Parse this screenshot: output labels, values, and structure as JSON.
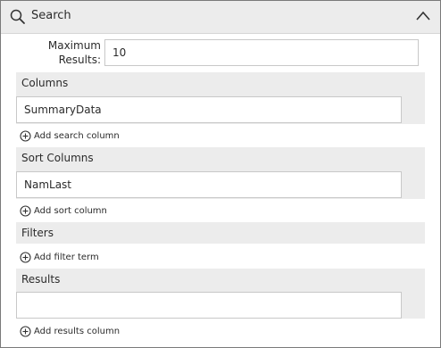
{
  "header": {
    "title": "Search",
    "search_icon": "search-icon",
    "collapse_icon": "chevron-up-icon"
  },
  "max_results": {
    "label_line1": "Maximum",
    "label_line2": "Results:",
    "value": "10"
  },
  "columns": {
    "title": "Columns",
    "items": [
      "SummaryData"
    ],
    "add_label": "Add search column"
  },
  "sort_columns": {
    "title": "Sort Columns",
    "items": [
      "NamLast"
    ],
    "add_label": "Add sort column"
  },
  "filters": {
    "title": "Filters",
    "add_label": "Add filter term"
  },
  "results": {
    "title": "Results",
    "value": "",
    "add_label": "Add results column"
  },
  "add_icon": "plus-circle-icon"
}
